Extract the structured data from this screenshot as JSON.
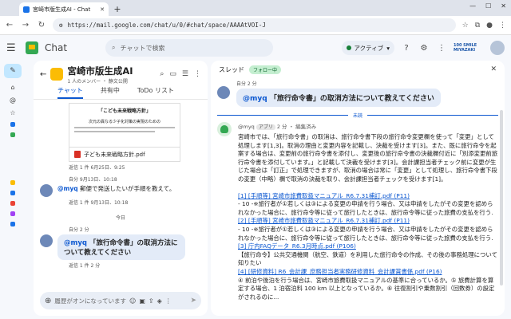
{
  "browser": {
    "tab_title": "宮崎市版生成AI - Chat",
    "url": "https://mail.google.com/chat/u/0/#chat/space/AAAAtVOI-J"
  },
  "app": {
    "title": "Chat",
    "search_placeholder": "チャットで検索",
    "status": "アクティブ",
    "brand": "100 SMILE MIYAZAKI"
  },
  "space": {
    "name": "宮崎市版生成AI",
    "subtitle": "1 人のメンバー ・ 静文公開",
    "tabs": [
      "チャット",
      "共有中",
      "ToDo リスト"
    ]
  },
  "left_messages": {
    "preview_title": "「こども未来戦略方針」",
    "preview_sub": "次元の異なる少子化対策の実現のための",
    "file_name": "子ども未来戦略方針.pdf",
    "meta1": "返信 1 件  6月25日、9:25",
    "date1": "自分 9月13日、10:18",
    "msg1_mention": "@myq",
    "msg1_text": "郵便で発送したいが手順を教えて。",
    "meta2": "返信 1 件  9月13日、10:18",
    "date_sep": "今日",
    "msg2_meta": "自分 2 分",
    "msg2_mention": "@myq",
    "msg2_text": "「旅行命令書」の取消方法について教えてください",
    "meta3": "返信 1 件  2 分"
  },
  "composer": {
    "placeholder": "履歴がオンになっています"
  },
  "thread": {
    "title": "スレッド",
    "badge": "フォロー中",
    "q_meta": "自分 2 分",
    "q_mention": "@myq",
    "q_text": "「旅行命令書」の取消方法について教えてください",
    "unread": "未読",
    "bot_name": "@myq",
    "bot_app": "アプリ",
    "bot_meta": "2 分 ・ 編集済み",
    "lines": [
      "宮崎市では、「旅行命令書」の取消は、旅行命令書下段の旅行命令変更欄を使って「変更」として処理します[1,3]。取消の理由と変更内容を記載し、決裁を受けます[3]。また、既に旅行命令を起案する場合は、変更前の旅行命令書を添付し、変更後の旅行命令書の決裁欄付近に「別添変更前旅行命令書を添付しています。」と記載して決裁を受けます[3]。会計課担当者チェック前に変更が生じた場合は「訂正」で処理できますが、取消の場合は常に「変更」として処理し、旅行命令書下段の変更（中略）欄で取消の決裁を取り、会計課担当者チェックを受けます[1]。",
      "[1] [手順等] 宮崎市旅費取扱マニュアル_R6.7.31補訂.pdf (P11)",
      "- 10 -※旅行者が①若しくは③による変更の申請を行う場合、又は申請をしたがその変更を認められなかった場合に、旅行命令等に従って旅行したときは、旅行命令等に従った旅費の支払を行う.",
      "[2] [手順等] 宮崎市旅費取扱マニュアル_R6.7.31補訂.pdf (P11)",
      "- 10 -※旅行者が①若しくは③による変更の申請を行う場合、又は申請をしたがその変更を認められなかった場合に、旅行命令等に従って旅行したときは、旅行命令等に従った旅費の支払を行う.",
      "[3] 庁内FAQデータ_R6.3月時点.pdf (P106)",
      "【旅行命令】公共交通機関（航空、鉄道）を利用した旅行命令の作成、その後の事務処理について知りたい",
      "[4] [研修資料] R6_会計課_庶務担当者実務研修資料_会計課賞書係.pdf (P16)",
      "④ 前泊や後泊を行う場合は、宮崎市旅費取扱マニュアルの基準に合っているか。⑤ 旅費計算を算定する場合、1 泊宿泊料 100 km 以上となっているか。⑥ 往復割引や乗数割引（回数券）の設定がされるのに..."
    ]
  }
}
